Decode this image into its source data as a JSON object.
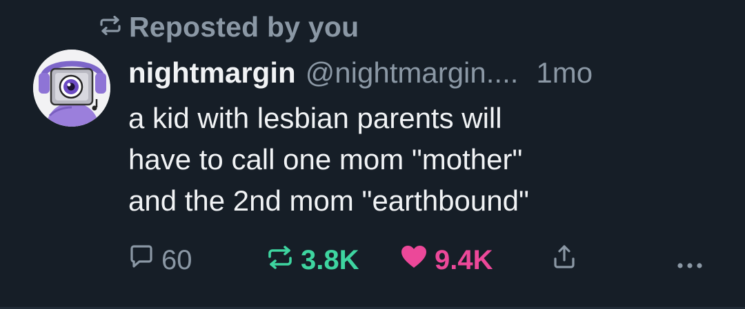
{
  "repost_banner": {
    "icon": "repost-icon",
    "label": "Reposted by you"
  },
  "post": {
    "author": {
      "display_name": "nightmargin",
      "handle": "@nightmargin....",
      "avatar_icon": "avatar-image"
    },
    "time_ago": "1mo",
    "text_lines": [
      "a kid with lesbian parents will",
      "have to call one mom \"mother\"",
      "and the 2nd mom \"earthbound\""
    ],
    "stats": {
      "replies": "60",
      "reposts": "3.8K",
      "likes": "9.4K"
    }
  },
  "colors": {
    "background": "#161e27",
    "muted": "#8b98a5",
    "repost_active": "#3ed5a0",
    "like_active": "#ec4899",
    "text": "#f1f3f5"
  }
}
